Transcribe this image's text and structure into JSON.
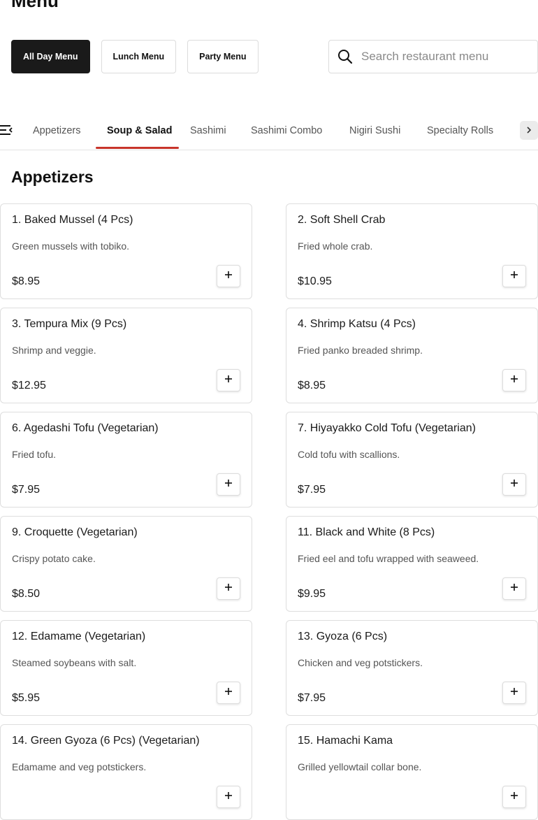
{
  "page": {
    "title": "Menu"
  },
  "menu_tabs": [
    {
      "label": "All Day Menu",
      "active": true
    },
    {
      "label": "Lunch Menu",
      "active": false
    },
    {
      "label": "Party Menu",
      "active": false
    }
  ],
  "search": {
    "placeholder": "Search restaurant menu",
    "value": ""
  },
  "categories": {
    "items": [
      {
        "label": "Appetizers",
        "active": false
      },
      {
        "label": "Soup & Salad",
        "active": true
      },
      {
        "label": "Sashimi",
        "active": false
      },
      {
        "label": "Sashimi Combo",
        "active": false
      },
      {
        "label": "Nigiri Sushi",
        "active": false
      },
      {
        "label": "Specialty Rolls",
        "active": false
      }
    ],
    "list_icon": "list-collapse-icon",
    "next_icon": "chevron-right-icon"
  },
  "section": {
    "title": "Appetizers"
  },
  "items": [
    {
      "name": "1. Baked Mussel (4 Pcs)",
      "description": "Green mussels with tobiko.",
      "price": "$8.95"
    },
    {
      "name": "2. Soft Shell Crab",
      "description": "Fried whole crab.",
      "price": "$10.95"
    },
    {
      "name": "3. Tempura Mix (9 Pcs)",
      "description": "Shrimp and veggie.",
      "price": "$12.95"
    },
    {
      "name": "4. Shrimp Katsu (4 Pcs)",
      "description": "Fried panko breaded shrimp.",
      "price": "$8.95"
    },
    {
      "name": "6. Agedashi Tofu (Vegetarian)",
      "description": "Fried tofu.",
      "price": "$7.95"
    },
    {
      "name": "7. Hiyayakko Cold Tofu (Vegetarian)",
      "description": "Cold tofu with scallions.",
      "price": "$7.95"
    },
    {
      "name": "9. Croquette (Vegetarian)",
      "description": "Crispy potato cake.",
      "price": "$8.50"
    },
    {
      "name": "11. Black and White (8 Pcs)",
      "description": "Fried eel and tofu wrapped with seaweed.",
      "price": "$9.95"
    },
    {
      "name": "12. Edamame (Vegetarian)",
      "description": "Steamed soybeans with salt.",
      "price": "$5.95"
    },
    {
      "name": "13. Gyoza (6 Pcs)",
      "description": "Chicken and veg potstickers.",
      "price": "$7.95"
    },
    {
      "name": "14. Green Gyoza (6 Pcs) (Vegetarian)",
      "description": "Edamame and veg potstickers.",
      "price": ""
    },
    {
      "name": "15. Hamachi Kama",
      "description": "Grilled yellowtail collar bone.",
      "price": ""
    }
  ],
  "icons": {
    "search": "search-icon",
    "add": "plus-icon"
  },
  "colors": {
    "accent": "#c8342a",
    "active_tab_bg": "#1a1a1a"
  }
}
